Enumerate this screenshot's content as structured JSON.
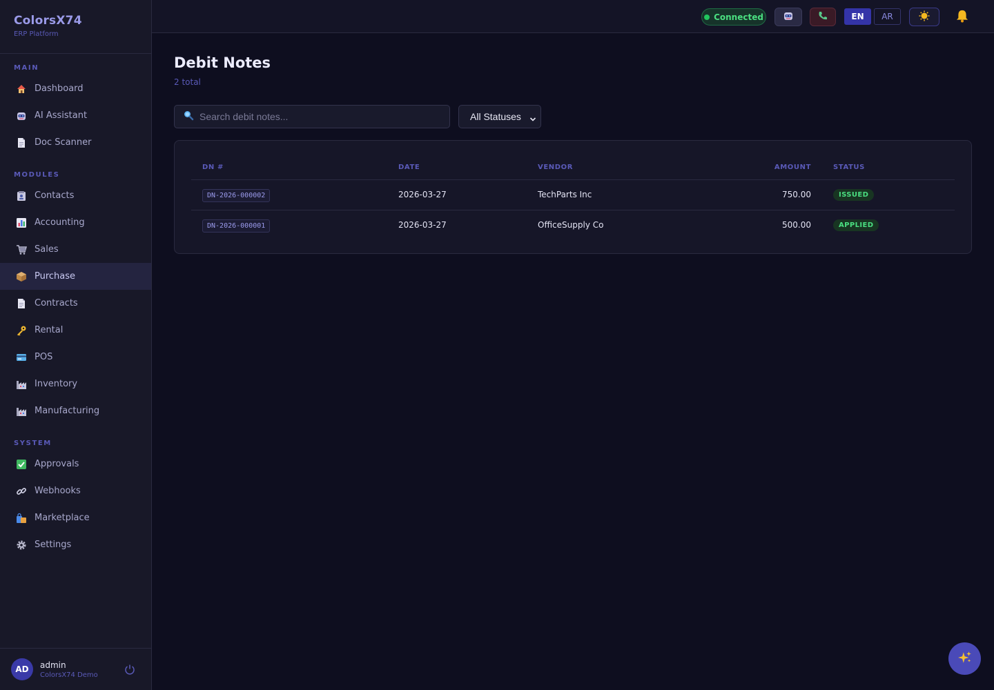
{
  "brand": {
    "title": "ColorsX74",
    "subtitle": "ERP Platform"
  },
  "sidebar": {
    "sections": [
      {
        "label": "MAIN",
        "items": [
          {
            "label": "Dashboard",
            "icon": "house-icon"
          },
          {
            "label": "AI Assistant",
            "icon": "robot-icon"
          },
          {
            "label": "Doc Scanner",
            "icon": "document-icon"
          }
        ]
      },
      {
        "label": "MODULES",
        "items": [
          {
            "label": "Contacts",
            "icon": "contacts-icon"
          },
          {
            "label": "Accounting",
            "icon": "chart-icon"
          },
          {
            "label": "Sales",
            "icon": "cart-icon"
          },
          {
            "label": "Purchase",
            "icon": "package-icon",
            "active": true
          },
          {
            "label": "Contracts",
            "icon": "document-icon"
          },
          {
            "label": "Rental",
            "icon": "key-icon"
          },
          {
            "label": "POS",
            "icon": "card-icon"
          },
          {
            "label": "Inventory",
            "icon": "factory-icon"
          },
          {
            "label": "Manufacturing",
            "icon": "factory-icon"
          }
        ]
      },
      {
        "label": "SYSTEM",
        "items": [
          {
            "label": "Approvals",
            "icon": "check-icon"
          },
          {
            "label": "Webhooks",
            "icon": "link-icon"
          },
          {
            "label": "Marketplace",
            "icon": "shopping-bags-icon"
          },
          {
            "label": "Settings",
            "icon": "gear-icon"
          }
        ]
      }
    ]
  },
  "user": {
    "initials": "AD",
    "name": "admin",
    "org": "ColorsX74 Demo"
  },
  "topbar": {
    "connection": "Connected",
    "languages": [
      "EN",
      "AR"
    ],
    "active_language": "EN"
  },
  "page": {
    "title": "Debit Notes",
    "count": "2 total",
    "search_placeholder": "Search debit notes...",
    "status_filter": "All Statuses"
  },
  "table": {
    "columns": [
      "DN #",
      "DATE",
      "VENDOR",
      "AMOUNT",
      "STATUS"
    ],
    "rows": [
      {
        "dn": "DN-2026-000002",
        "date": "2026-03-27",
        "vendor": "TechParts Inc",
        "amount": "750.00",
        "status": "ISSUED"
      },
      {
        "dn": "DN-2026-000001",
        "date": "2026-03-27",
        "vendor": "OfficeSupply Co",
        "amount": "500.00",
        "status": "APPLIED"
      }
    ]
  },
  "colors": {
    "background": "#0e0e1f",
    "sidebar": "#181828",
    "accent": "#5a5ab8",
    "success": "#4ade80"
  }
}
